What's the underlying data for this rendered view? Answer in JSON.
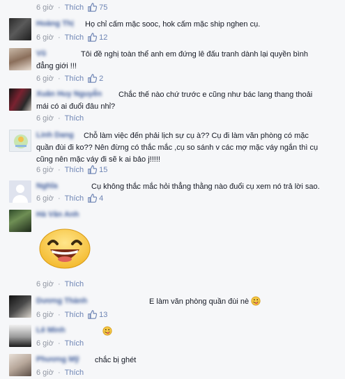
{
  "comments": [
    {
      "name": "",
      "text": "",
      "time": "6 giờ",
      "like": "Thích",
      "count": "75"
    },
    {
      "name": "Hoàng Thị",
      "text": "Họ chỉ cấm mặc sooc, hok cấm mặc ship nghen cụ.",
      "time": "6 giờ",
      "like": "Thích",
      "count": "12"
    },
    {
      "name": "Vũ",
      "text": "Tôi đề nghị toàn thể anh em đứng lê đấu tranh dành lại quyền bình đẳng giới !!!",
      "time": "6 giờ",
      "like": "Thích",
      "count": "2"
    },
    {
      "name": "Xuân Huy Nguyễn",
      "text": "Chắc thế nào chứ trước e cũng như bác lang thang thoải mái có ai đuổi đâu nhỉ?",
      "time": "6 giờ",
      "like": "Thích",
      "count": ""
    },
    {
      "name": "Linh Dang",
      "text": "Chỗ làm việc đến phải lịch sự cụ à?? Cụ đi làm văn phòng có mặc quần đùi đi ko?? Nên đừng có thắc mắc ,cụ so sánh v các mợ mặc váy ngắn thì cụ cũng nên mặc váy đi sẽ k ai bảo j!!!!!",
      "time": "6 giờ",
      "like": "Thích",
      "count": "15"
    },
    {
      "name": "Nghĩa",
      "text": "Cụ không thắc mắc hỏi thẳng thằng nào đuổi cụ xem nó trả lời sao.",
      "time": "6 giờ",
      "like": "Thích",
      "count": "4"
    },
    {
      "name": "Hà Vân Anh",
      "text": "",
      "time": "6 giờ",
      "like": "Thích",
      "count": ""
    },
    {
      "name": "Dương Thành",
      "text": "E làm văn phòng quần đùi nè",
      "time": "6 giờ",
      "like": "Thích",
      "count": "13"
    },
    {
      "name": "Lê Minh",
      "text": "",
      "time": "6 giờ",
      "like": "Thích",
      "count": ""
    },
    {
      "name": "Phương Mỹ",
      "text": "chắc bị ghét",
      "time": "6 giờ",
      "like": "Thích",
      "count": ""
    }
  ],
  "colors": {
    "link": "#3b5998",
    "meta": "#9197a3",
    "like_blue": "#6d84b4"
  },
  "icons": {
    "like": "thumbs-up-icon",
    "emoji": "laughing-emoticon-icon",
    "avatar": "user-avatar"
  }
}
